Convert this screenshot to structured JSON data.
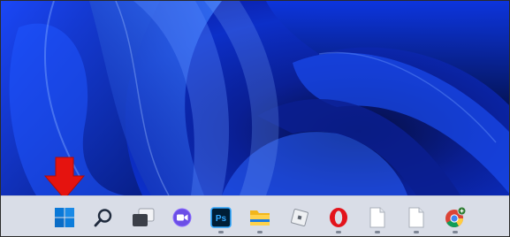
{
  "desktop": {
    "wallpaper": "windows-11-bloom-blue",
    "colors": {
      "deep": "#050d3f",
      "mid": "#0b2bc9",
      "bright": "#2f6bff",
      "highlight": "#8ab4ff"
    }
  },
  "annotation": {
    "icon": "red-down-arrow",
    "color": "#e5130f",
    "target": "start-button"
  },
  "taskbar": {
    "background": "#d9dde7",
    "items": [
      {
        "id": "start",
        "icon": "windows-logo-icon",
        "running": false
      },
      {
        "id": "search",
        "icon": "search-icon",
        "running": false
      },
      {
        "id": "task-view",
        "icon": "task-view-icon",
        "running": false
      },
      {
        "id": "chat",
        "icon": "chat-icon",
        "running": false
      },
      {
        "id": "photoshop",
        "icon": "photoshop-icon",
        "label": "Ps",
        "running": true
      },
      {
        "id": "file-explorer",
        "icon": "folder-icon",
        "running": true
      },
      {
        "id": "roblox",
        "icon": "roblox-icon",
        "running": false
      },
      {
        "id": "opera",
        "icon": "opera-icon",
        "running": true
      },
      {
        "id": "document-1",
        "icon": "document-icon",
        "running": true
      },
      {
        "id": "document-2",
        "icon": "document-icon",
        "running": true
      },
      {
        "id": "chrome",
        "icon": "chrome-icon",
        "running": true
      }
    ]
  }
}
